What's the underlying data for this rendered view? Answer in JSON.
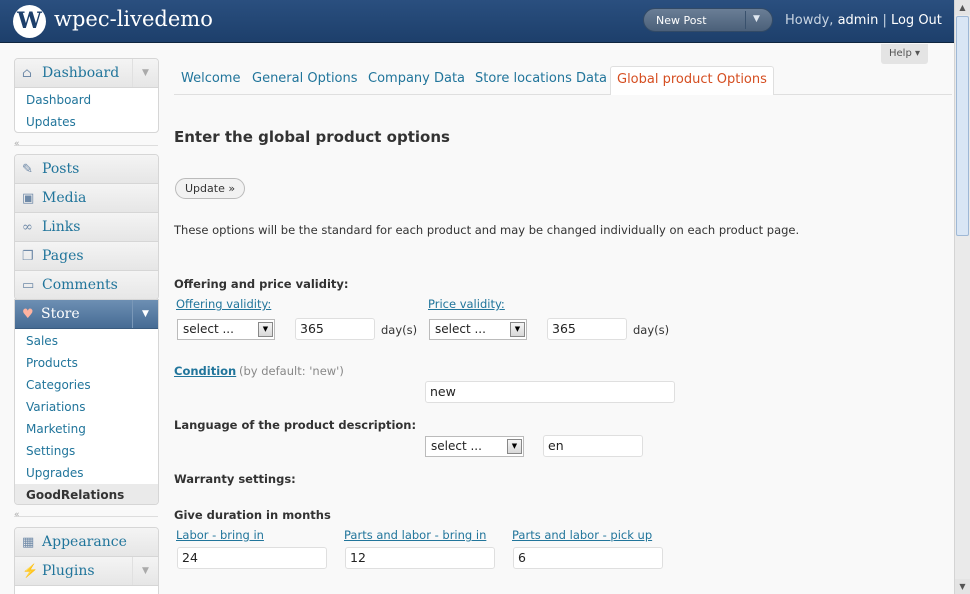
{
  "header": {
    "site_title": "wpec-livedemo",
    "new_post_label": "New Post",
    "howdy_prefix": "Howdy, ",
    "user": "admin",
    "separator": " | ",
    "logout": "Log Out"
  },
  "help_label": "Help ▾",
  "sidebar": {
    "dashboard": {
      "label": "Dashboard",
      "items": [
        "Dashboard",
        "Updates"
      ]
    },
    "main": [
      "Posts",
      "Media",
      "Links",
      "Pages",
      "Comments"
    ],
    "store": {
      "label": "Store",
      "items": [
        "Sales",
        "Products",
        "Categories",
        "Variations",
        "Marketing",
        "Settings",
        "Upgrades",
        "GoodRelations"
      ]
    },
    "bottom": [
      "Appearance",
      "Plugins"
    ]
  },
  "tabs": [
    "Welcome",
    "General Options",
    "Company Data",
    "Store locations Data",
    "Global product Options"
  ],
  "page": {
    "title": "Enter the global product options",
    "update_button": "Update »",
    "intro": "These options will be the standard for each product and may be changed individually on each product page.",
    "offering_heading": "Offering and price validity:",
    "offering_validity_label": "Offering validity:",
    "price_validity_label": "Price validity:",
    "select_placeholder": "select ...",
    "offering_days": "365",
    "price_days": "365",
    "days_unit": "day(s)",
    "condition_label": "Condition",
    "condition_default": "(by default: 'new')",
    "condition_value": "new",
    "language_heading": "Language of the product description:",
    "language_value": "en",
    "warranty_heading": "Warranty settings:",
    "duration_heading": "Give duration in months",
    "labor_bring_in_label": "Labor - bring in",
    "parts_labor_bring_in_label": "Parts and labor - bring in",
    "parts_labor_pick_up_label": "Parts and labor - pick up",
    "labor_bring_in_value": "24",
    "parts_labor_bring_in_value": "12",
    "parts_labor_pick_up_value": "6"
  }
}
